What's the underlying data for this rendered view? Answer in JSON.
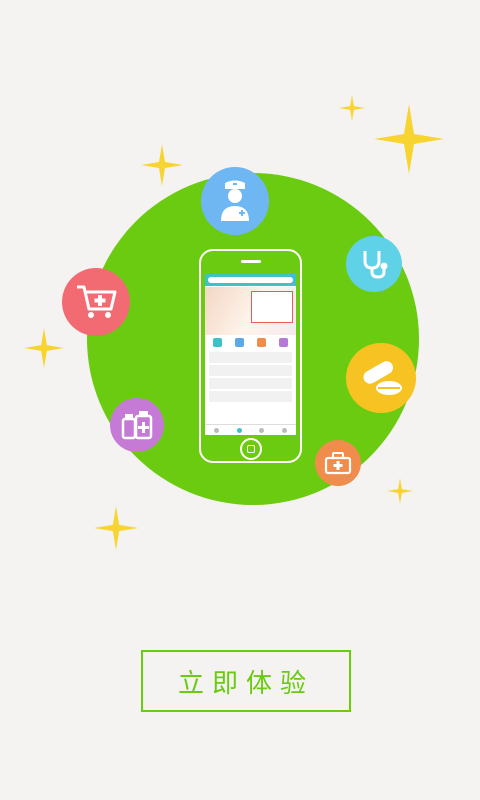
{
  "cta": {
    "label": "立即体验"
  },
  "colors": {
    "background": "#f4f3f1",
    "circle": "#6bcb10",
    "accent": "#6bcb10",
    "sparkle": "#f8d431"
  },
  "icons": [
    "nurse-icon",
    "shopping-cart-icon",
    "stethoscope-icon",
    "pills-icon",
    "medicine-bottles-icon",
    "first-aid-kit-icon",
    "sparkle-icon"
  ]
}
